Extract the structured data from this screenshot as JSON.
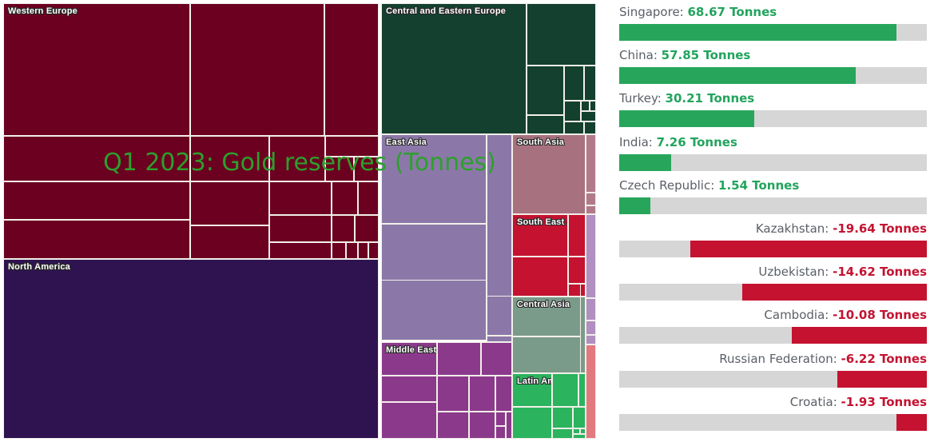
{
  "treemap": {
    "title": "Q1 2023: Gold reserves (Tonnes)",
    "title_color": "#2ca02c",
    "groups": [
      {
        "label": "Western Europe",
        "color": "#6b0020"
      },
      {
        "label": "North America",
        "color": "#2e1350"
      },
      {
        "label": "Central and Eastern Europe",
        "color": "#13402f"
      },
      {
        "label": "East Asia",
        "color": "#8b78a8"
      },
      {
        "label": "South Asia",
        "color": "#a8717f"
      },
      {
        "label": "South East Asia",
        "color": "#c41230"
      },
      {
        "label": "Central Asia",
        "color": "#7a9b8a"
      },
      {
        "label": "Middle East & North Africa",
        "color": "#8b3a8b"
      },
      {
        "label": "Latin America ...",
        "color": "#2bb35e"
      },
      {
        "label": "",
        "color": "#b07a8a"
      },
      {
        "label": "",
        "color": "#e2797f"
      }
    ]
  },
  "chart_data": {
    "type": "bar",
    "title": "Q1 2023: Gold reserves (Tonnes)",
    "unit": "Tonnes",
    "orientation": "horizontal",
    "grid": false,
    "xlabel": "",
    "ylabel": "",
    "positive_color": "#27a65b",
    "negative_color": "#c41230",
    "track_color": "#d6d6d6",
    "categories": [
      "Singapore",
      "China",
      "Turkey",
      "India",
      "Czech Republic",
      "Kazakhstan",
      "Uzbekistan",
      "Cambodia",
      "Russian Federation",
      "Croatia"
    ],
    "values": [
      68.67,
      57.85,
      30.21,
      7.26,
      1.54,
      -19.64,
      -14.62,
      -10.08,
      -6.22,
      -1.93
    ],
    "bars": [
      {
        "name": "Singapore",
        "value": 68.67,
        "label": "Singapore: ",
        "value_label": "68.67 Tonnes",
        "sign": "pos",
        "pct": 90
      },
      {
        "name": "China",
        "value": 57.85,
        "label": "China: ",
        "value_label": "57.85 Tonnes",
        "sign": "pos",
        "pct": 77
      },
      {
        "name": "Turkey",
        "value": 30.21,
        "label": "Turkey: ",
        "value_label": "30.21 Tonnes",
        "sign": "pos",
        "pct": 44
      },
      {
        "name": "India",
        "value": 7.26,
        "label": "India: ",
        "value_label": "7.26 Tonnes",
        "sign": "pos",
        "pct": 17
      },
      {
        "name": "Czech Republic",
        "value": 1.54,
        "label": "Czech Republic: ",
        "value_label": "1.54 Tonnes",
        "sign": "pos",
        "pct": 10
      },
      {
        "name": "Kazakhstan",
        "value": -19.64,
        "label": "Kazakhstan: ",
        "value_label": "-19.64 Tonnes",
        "sign": "neg",
        "pct": 77
      },
      {
        "name": "Uzbekistan",
        "value": -14.62,
        "label": "Uzbekistan: ",
        "value_label": "-14.62 Tonnes",
        "sign": "neg",
        "pct": 60
      },
      {
        "name": "Cambodia",
        "value": -10.08,
        "label": "Cambodia: ",
        "value_label": "-10.08 Tonnes",
        "sign": "neg",
        "pct": 44
      },
      {
        "name": "Russian Federation",
        "value": -6.22,
        "label": "Russian Federation: ",
        "value_label": "-6.22 Tonnes",
        "sign": "neg",
        "pct": 29
      },
      {
        "name": "Croatia",
        "value": -1.93,
        "label": "Croatia: ",
        "value_label": "-1.93 Tonnes",
        "sign": "neg",
        "pct": 10
      }
    ]
  }
}
